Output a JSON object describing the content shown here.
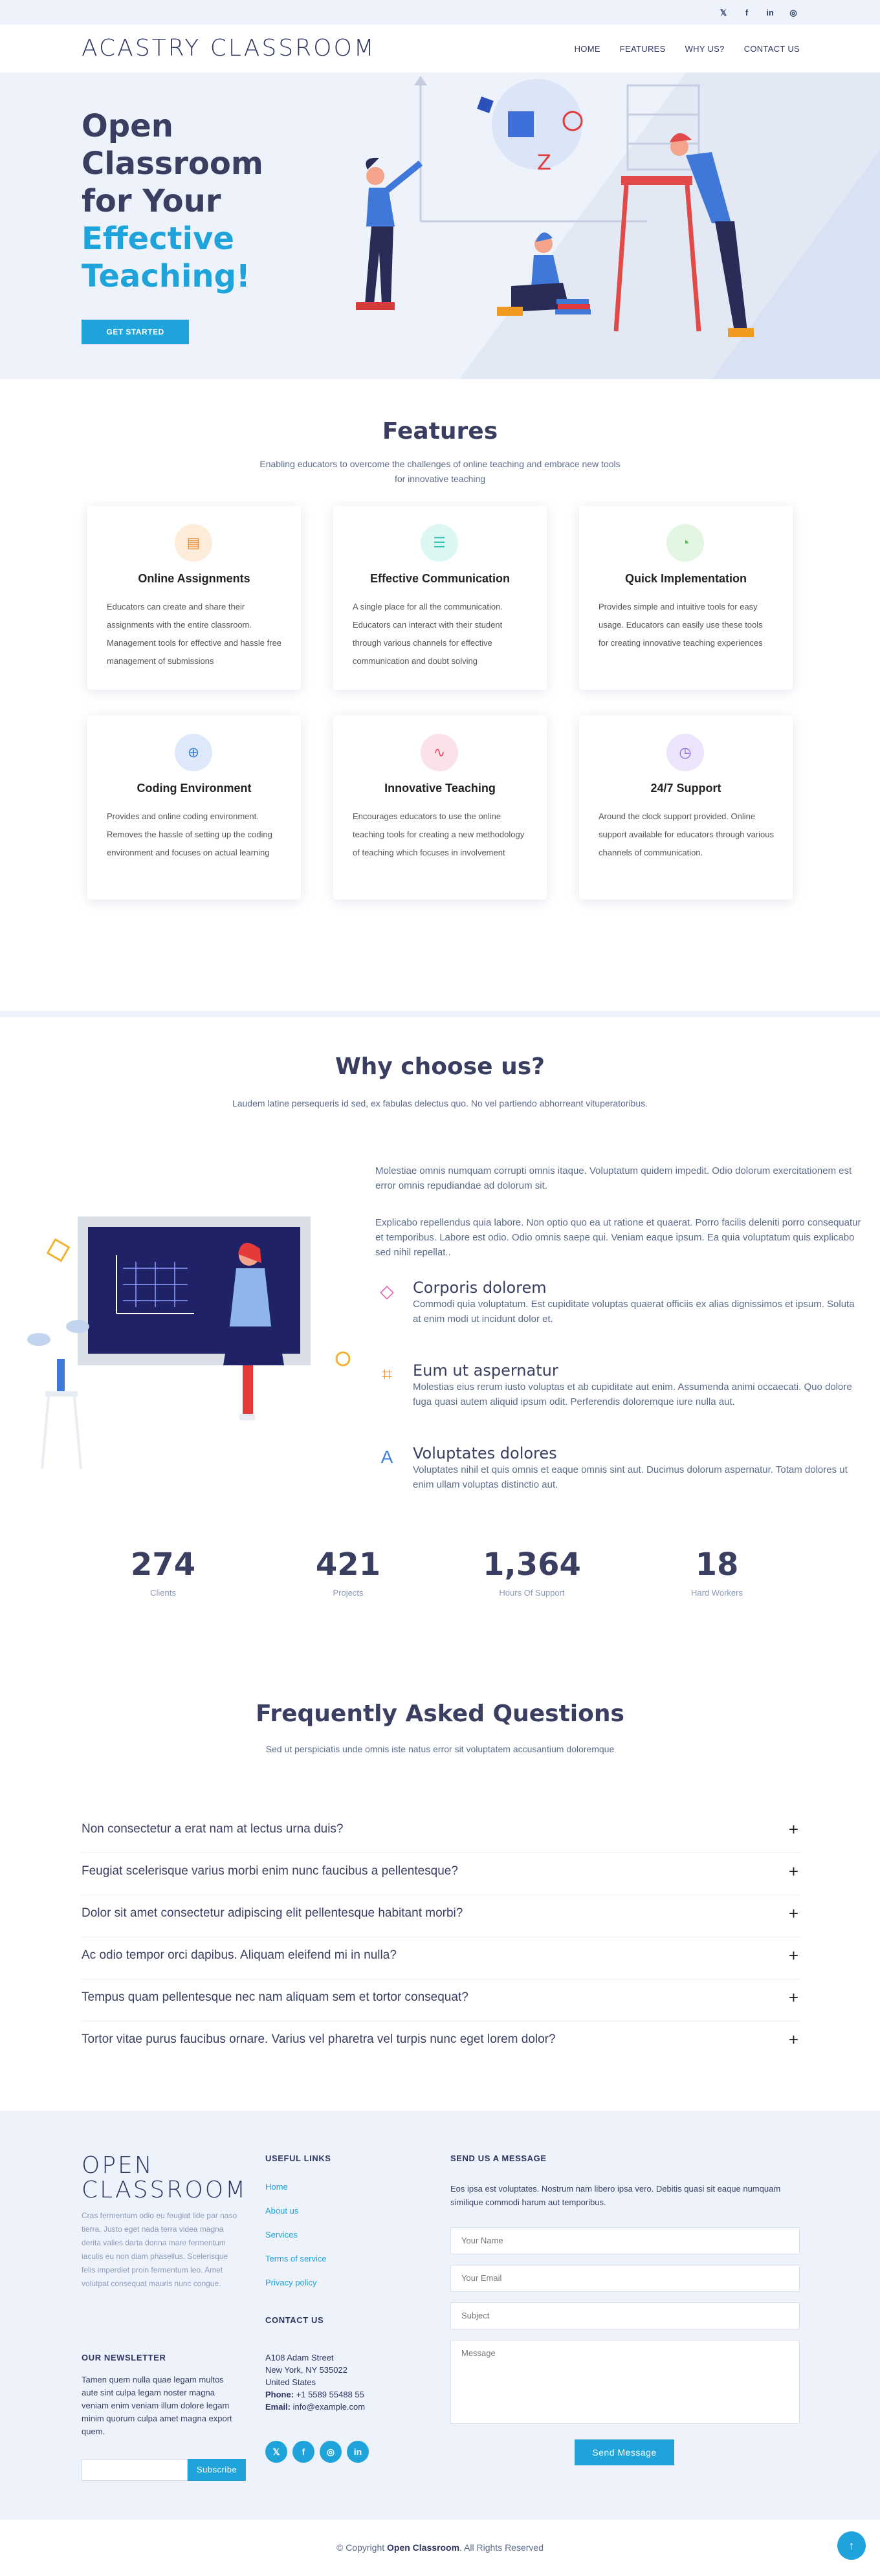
{
  "topbar": {
    "social": [
      {
        "icon": "twitter-icon",
        "glyph": "𝕏"
      },
      {
        "icon": "facebook-icon",
        "glyph": "f"
      },
      {
        "icon": "linkedin-icon",
        "glyph": "in"
      },
      {
        "icon": "instagram-icon",
        "glyph": "◎"
      }
    ]
  },
  "header": {
    "logo": "ACASTRY CLASSROOM",
    "nav": [
      "HOME",
      "FEATURES",
      "WHY US?",
      "CONTACT US"
    ]
  },
  "hero": {
    "line1": "Open",
    "line2": "Classroom",
    "line3": "for Your",
    "line4": "Effective",
    "line5": "Teaching!",
    "cta": "GET STARTED"
  },
  "features": {
    "title": "Features",
    "subtitle": "Enabling educators to overcome the challenges of online teaching and embrace new tools for innovative teaching",
    "items": [
      {
        "icon": "document-icon",
        "title": "Online Assignments",
        "text": "Educators can create and share their assignments with the entire classroom. Management tools for effective and hassle free management of submissions",
        "bg": "#fdecd9",
        "color": "#e8913b"
      },
      {
        "icon": "chat-icon",
        "title": "Effective Communication",
        "text": "A single place for all the communication. Educators can interact with their student through various channels for effective communication and doubt solving",
        "bg": "#dbf6f3",
        "color": "#3cc4b3"
      },
      {
        "icon": "speedometer-icon",
        "title": "Quick Implementation",
        "text": "Provides simple and intuitive tools for easy usage. Educators can easily use these tools for creating innovative teaching experiences",
        "bg": "#e2f6e1",
        "color": "#4fbf4b"
      },
      {
        "icon": "globe-icon",
        "title": "Coding Environment",
        "text": "Provides and online coding environment. Removes the hassle of setting up the coding environment and focuses on actual learning",
        "bg": "#dde9fa",
        "color": "#3f7fd8"
      },
      {
        "icon": "pulse-icon",
        "title": "Innovative Teaching",
        "text": "Encourages educators to use the online teaching tools for creating a new methodology of teaching which focuses in involvement",
        "bg": "#fbe2e8",
        "color": "#e5506f"
      },
      {
        "icon": "clock-icon",
        "title": "24/7 Support",
        "text": "Around the clock support provided. Online support available for educators through various channels of communication.",
        "bg": "#ebe4fb",
        "color": "#8d68e0"
      }
    ]
  },
  "why": {
    "title": "Why choose us?",
    "subtitle": "Laudem latine persequeris id sed, ex fabulas delectus quo. No vel partiendo abhorreant vituperatoribus.",
    "para1": "Molestiae omnis numquam corrupti omnis itaque. Voluptatum quidem impedit. Odio dolorum exercitationem est error omnis repudiandae ad dolorum sit.",
    "para2": "Explicabo repellendus quia labore. Non optio quo ea ut ratione et quaerat. Porro facilis deleniti porro consequatur et temporibus. Labore est odio. Odio omnis saepe qui. Veniam eaque ipsum. Ea quia voluptatum quis explicabo sed nihil repellat..",
    "items": [
      {
        "icon": "diamond-icon",
        "glyph": "◇",
        "color": "#e25ab0",
        "title": "Corporis dolorem",
        "text": "Commodi quia voluptatum. Est cupiditate voluptas quaerat officiis ex alias dignissimos et ipsum. Soluta at enim modi ut incidunt dolor et."
      },
      {
        "icon": "drafting-icon",
        "glyph": "⌗",
        "color": "#ee9a3b",
        "title": "Eum ut aspernatur",
        "text": "Molestias eius rerum iusto voluptas et ab cupiditate aut enim. Assumenda animi occaecati. Quo dolore fuga quasi autem aliquid ipsum odit. Perferendis doloremque iure nulla aut."
      },
      {
        "icon": "translate-icon",
        "glyph": "A",
        "color": "#3f7fd8",
        "title": "Voluptates dolores",
        "text": "Voluptates nihil et quis omnis et eaque omnis sint aut. Ducimus dolorum aspernatur. Totam dolores ut enim ullam voluptas distinctio aut."
      }
    ],
    "stats": [
      {
        "value": "274",
        "label": "Clients"
      },
      {
        "value": "421",
        "label": "Projects"
      },
      {
        "value": "1,364",
        "label": "Hours Of Support"
      },
      {
        "value": "18",
        "label": "Hard Workers"
      }
    ]
  },
  "faq": {
    "title": "Frequently Asked Questions",
    "subtitle": "Sed ut perspiciatis unde omnis iste natus error sit voluptatem accusantium doloremque",
    "items": [
      "Non consectetur a erat nam at lectus urna duis?",
      "Feugiat scelerisque varius morbi enim nunc faucibus a pellentesque?",
      "Dolor sit amet consectetur adipiscing elit pellentesque habitant morbi?",
      "Ac odio tempor orci dapibus. Aliquam eleifend mi in nulla?",
      "Tempus quam pellentesque nec nam aliquam sem et tortor consequat?",
      "Tortor vitae purus faucibus ornare. Varius vel pharetra vel turpis nunc eget lorem dolor?"
    ],
    "toggle": "+"
  },
  "footer": {
    "logo_line1": "OPEN",
    "logo_line2": "CLASSROOM",
    "description": "Cras fermentum odio eu feugiat lide par naso tierra. Justo eget nada terra videa magna derita valies darta donna mare fermentum iaculis eu non diam phasellus. Scelerisque felis imperdiet proin fermentum leo. Amet volutpat consequat mauris nunc congue.",
    "newsletter_heading": "OUR NEWSLETTER",
    "newsletter_text": "Tamen quem nulla quae legam multos aute sint culpa legam noster magna veniam enim veniam illum dolore legam minim quorum culpa amet magna export quem.",
    "subscribe": "Subscribe",
    "links_heading": "USEFUL LINKS",
    "links": [
      "Home",
      "About us",
      "Services",
      "Terms of service",
      "Privacy policy"
    ],
    "contact_heading": "CONTACT US",
    "address1": "A108 Adam Street",
    "address2": "New York, NY 535022",
    "address3": "United States",
    "phone_label": "Phone:",
    "phone": "+1 5589 55488 55",
    "email_label": "Email:",
    "email": "info@example.com",
    "social": [
      "𝕏",
      "f",
      "◎",
      "in"
    ],
    "message_heading": "SEND US A MESSAGE",
    "message_text": "Eos ipsa est voluptates. Nostrum nam libero ipsa vero. Debitis quasi sit eaque numquam similique commodi harum aut temporibus.",
    "name_placeholder": "Your Name",
    "email_placeholder": "Your Email",
    "subject_placeholder": "Subject",
    "message_placeholder": "Message",
    "send": "Send Message"
  },
  "copyright": {
    "prefix": "© Copyright ",
    "brand": "Open Classroom",
    "suffix": ". All Rights Reserved"
  },
  "totop": "↑",
  "colors": {
    "accent": "#1ea3db",
    "heading": "#3a3f62",
    "bg_light": "#eef3fb"
  }
}
